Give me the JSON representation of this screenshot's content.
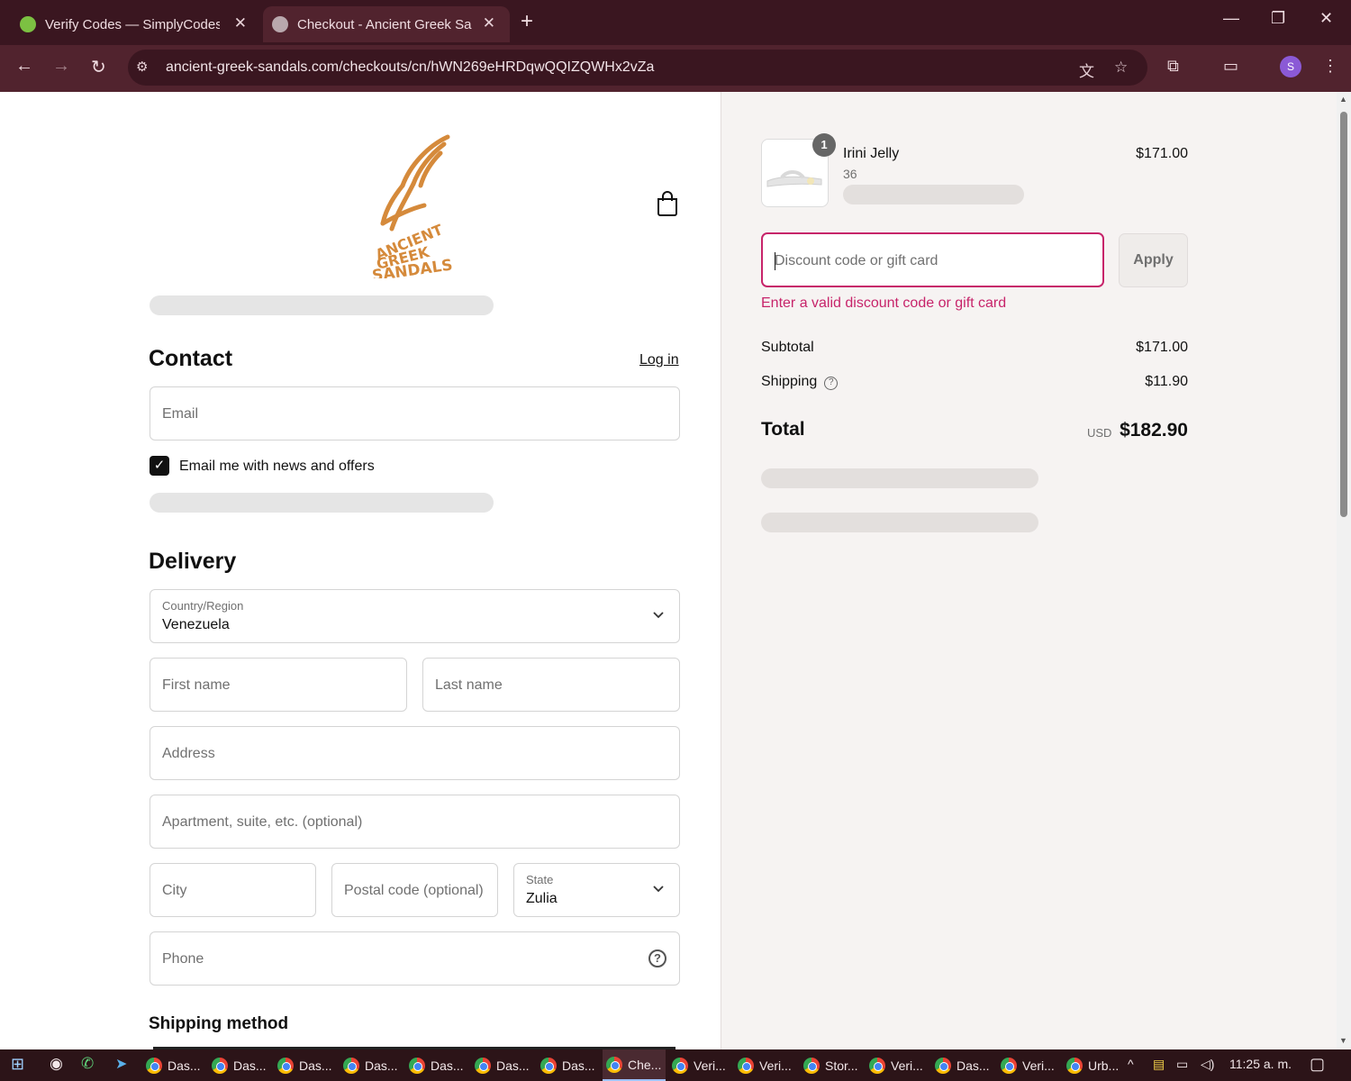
{
  "browser": {
    "tabs": [
      {
        "title": "Verify Codes — SimplyCodes",
        "active": false
      },
      {
        "title": "Checkout - Ancient Greek Sand",
        "active": true
      }
    ],
    "url": "ancient-greek-sandals.com/checkouts/cn/hWN269eHRDqwQQIZQWHx2vZa",
    "profile_initial": "S"
  },
  "brand": {
    "logo_text": "ANCIENT GREEK SANDALS",
    "logo_color": "#d58a3b"
  },
  "contact": {
    "heading": "Contact",
    "login_link": "Log in",
    "email_placeholder": "Email",
    "newsletter_label": "Email me with news and offers",
    "newsletter_checked": true
  },
  "delivery": {
    "heading": "Delivery",
    "country_label": "Country/Region",
    "country_value": "Venezuela",
    "first_name_placeholder": "First name",
    "last_name_placeholder": "Last name",
    "address_placeholder": "Address",
    "apartment_placeholder": "Apartment, suite, etc. (optional)",
    "city_placeholder": "City",
    "postal_placeholder": "Postal code (optional)",
    "state_label": "State",
    "state_value": "Zulia",
    "phone_placeholder": "Phone"
  },
  "shipping_method": {
    "heading": "Shipping method"
  },
  "summary": {
    "item": {
      "quantity": "1",
      "name": "Irini Jelly",
      "variant": "36",
      "price": "$171.00"
    },
    "discount_placeholder": "Discount code or gift card",
    "apply_label": "Apply",
    "discount_error": "Enter a valid discount code or gift card",
    "subtotal_label": "Subtotal",
    "subtotal_value": "$171.00",
    "shipping_label": "Shipping",
    "shipping_value": "$11.90",
    "total_label": "Total",
    "total_currency": "USD",
    "total_value": "$182.90"
  },
  "colors": {
    "accent_error": "#c7246a",
    "chrome_bg": "#51232e"
  },
  "taskbar": {
    "items": [
      "Das...",
      "Das...",
      "Das...",
      "Das...",
      "Das...",
      "Das...",
      "Das...",
      "Che...",
      "Veri...",
      "Veri...",
      "Stor...",
      "Veri...",
      "Das...",
      "Veri...",
      "Urb..."
    ],
    "active_index": 7,
    "clock": "11:25 a. m."
  }
}
